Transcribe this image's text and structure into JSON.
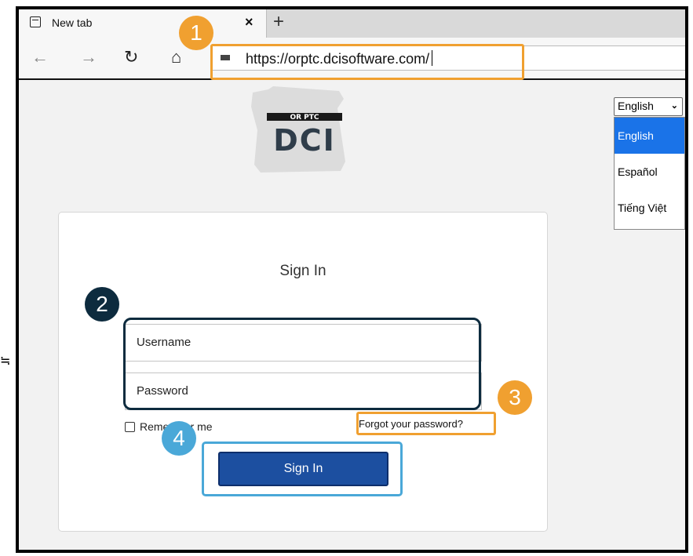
{
  "browser": {
    "tab_title": "New tab",
    "tab_close": "×",
    "new_tab": "+",
    "back": "←",
    "forward": "→",
    "refresh": "↻",
    "home": "⌂",
    "url": "https://orptc.dcisoftware.com/"
  },
  "logo": {
    "top_text": "OR PTC",
    "main_text": "DCI"
  },
  "language": {
    "selected": "English",
    "options": [
      "English",
      "Español",
      "Tiếng Việt"
    ]
  },
  "signin_card": {
    "title": "Sign In",
    "username_placeholder": "Username",
    "password_placeholder": "Password",
    "remember_label": "Remember me",
    "forgot_link": "Forgot your password?",
    "button_label": "Sign In"
  },
  "annotations": {
    "one": "1",
    "two": "2",
    "three": "3",
    "four": "4"
  },
  "side_mark": "≒",
  "colors": {
    "orange": "#f0a030",
    "dark": "#0d2b3e",
    "blue": "#4aa8d8",
    "button": "#1c4fa0"
  }
}
